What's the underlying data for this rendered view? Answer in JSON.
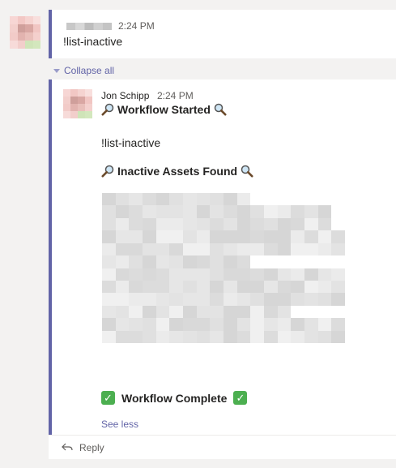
{
  "first_message": {
    "time": "2:24 PM",
    "text": "!list-inactive"
  },
  "thread": {
    "collapse_label": "Collapse all",
    "author": "Jon Schipp",
    "time": "2:24 PM",
    "workflow_started": "Workflow Started",
    "command": "!list-inactive",
    "inactive_assets_title": "Inactive Assets Found",
    "workflow_complete": "Workflow Complete",
    "see_less": "See less",
    "reply": "Reply"
  },
  "colors": {
    "accent": "#6264a7",
    "check_green": "#4caf50"
  },
  "icons": [
    "magnifier-icon",
    "check-mark-icon",
    "reply-icon",
    "collapse-caret-icon"
  ]
}
